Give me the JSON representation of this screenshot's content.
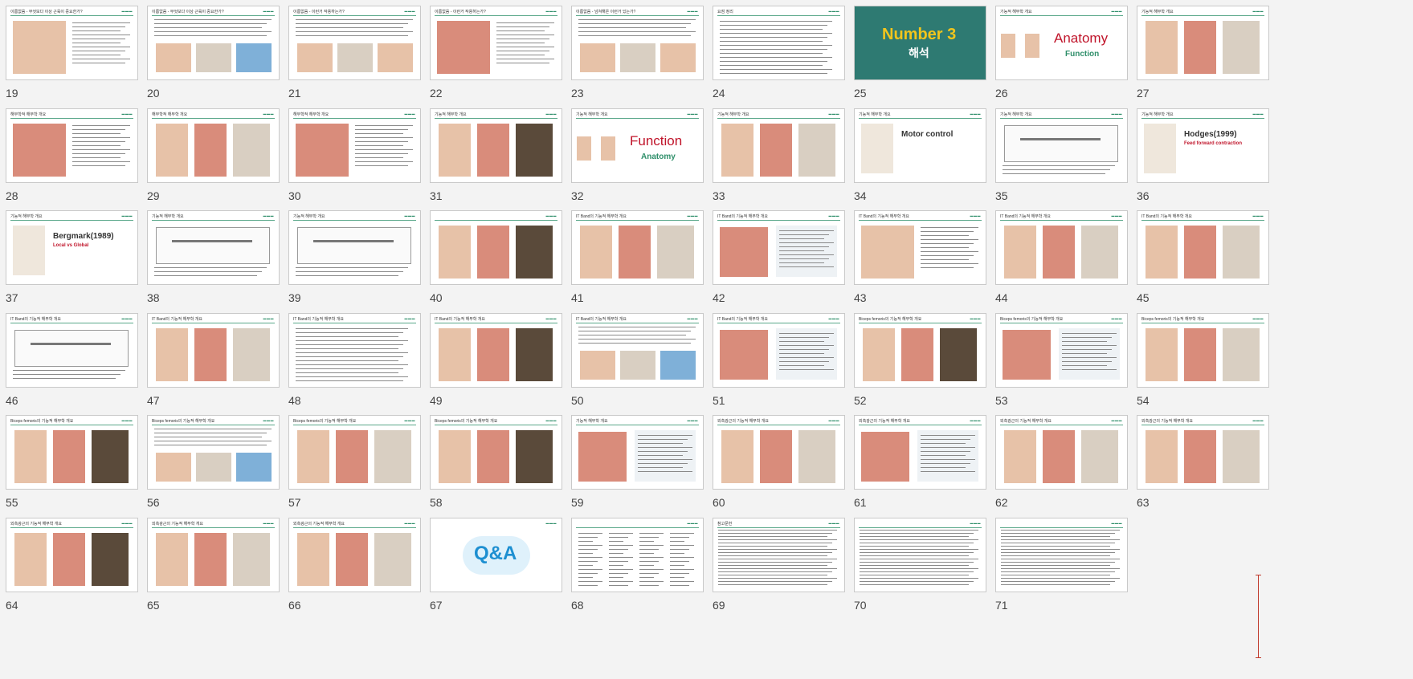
{
  "slides": [
    {
      "n": "19",
      "title": "이름없음 - 무엇보다 이상 근육이 중요한가?",
      "kind": "image-text"
    },
    {
      "n": "20",
      "title": "이름없음 - 무엇보다 이상 근육이 중요한가?",
      "kind": "text-images"
    },
    {
      "n": "21",
      "title": "이름없음 - 이런거 작용하는가?",
      "kind": "text-images"
    },
    {
      "n": "22",
      "title": "이름없음 - 이런거 작용하는가?",
      "kind": "image-text"
    },
    {
      "n": "23",
      "title": "이름없음 - 넘쳐해온 이런거 있는가?",
      "kind": "text-images"
    },
    {
      "n": "24",
      "title": "요점 정리",
      "kind": "text"
    },
    {
      "n": "25",
      "title": "",
      "kind": "cover",
      "big": "Number 3",
      "sub": "해석"
    },
    {
      "n": "26",
      "title": "기능적 해부학 개요",
      "kind": "label",
      "big": "Anatomy",
      "sub": "Function"
    },
    {
      "n": "27",
      "title": "기능적 해부학 개요",
      "kind": "images"
    },
    {
      "n": "28",
      "title": "해부학적 해부학 개요",
      "kind": "image-text"
    },
    {
      "n": "29",
      "title": "해부학적 해부학 개요",
      "kind": "images"
    },
    {
      "n": "30",
      "title": "해부학적 해부학 개요",
      "kind": "image-text"
    },
    {
      "n": "31",
      "title": "기능적 해부학 개요",
      "kind": "images"
    },
    {
      "n": "32",
      "title": "기능적 해부학 개요",
      "kind": "label",
      "big": "Function",
      "sub": "Anatomy"
    },
    {
      "n": "33",
      "title": "기능적 해부학 개요",
      "kind": "images"
    },
    {
      "n": "34",
      "title": "기능적 해부학 개요",
      "kind": "label-small",
      "big": "Motor control",
      "sub": ""
    },
    {
      "n": "35",
      "title": "기능적 해부학 개요",
      "kind": "diagram"
    },
    {
      "n": "36",
      "title": "기능적 해부학 개요",
      "kind": "label-small",
      "big": "Hodges(1999)",
      "sub": "Feed forward contraction"
    },
    {
      "n": "37",
      "title": "기능적 해부학 개요",
      "kind": "label-small",
      "big": "Bergmark(1989)",
      "sub": "Local vs Global"
    },
    {
      "n": "38",
      "title": "기능적 해부학 개요",
      "kind": "diagram"
    },
    {
      "n": "39",
      "title": "기능적 해부학 개요",
      "kind": "diagram"
    },
    {
      "n": "40",
      "title": "",
      "kind": "images"
    },
    {
      "n": "41",
      "title": "IT Band의 기능적 해부학 개요",
      "kind": "images"
    },
    {
      "n": "42",
      "title": "IT Band의 기능적 해부학 개요",
      "kind": "table"
    },
    {
      "n": "43",
      "title": "IT Band의 기능적 해부학 개요",
      "kind": "image-text"
    },
    {
      "n": "44",
      "title": "IT Band의 기능적 해부학 개요",
      "kind": "images"
    },
    {
      "n": "45",
      "title": "IT Band의 기능적 해부학 개요",
      "kind": "images"
    },
    {
      "n": "46",
      "title": "IT Band의 기능적 해부학 개요",
      "kind": "diagram"
    },
    {
      "n": "47",
      "title": "IT Band의 기능적 해부학 개요",
      "kind": "images"
    },
    {
      "n": "48",
      "title": "IT Band의 기능적 해부학 개요",
      "kind": "text"
    },
    {
      "n": "49",
      "title": "IT Band의 기능적 해부학 개요",
      "kind": "images"
    },
    {
      "n": "50",
      "title": "IT Band의 기능적 해부학 개요",
      "kind": "text-images"
    },
    {
      "n": "51",
      "title": "IT Band의 기능적 해부학 개요",
      "kind": "table"
    },
    {
      "n": "52",
      "title": "Biceps femoris의 기능적 해부학 개요",
      "kind": "images"
    },
    {
      "n": "53",
      "title": "Biceps femoris의 기능적 해부학 개요",
      "kind": "table"
    },
    {
      "n": "54",
      "title": "Biceps femoris의 기능적 해부학 개요",
      "kind": "images"
    },
    {
      "n": "55",
      "title": "Biceps femoris의 기능적 해부학 개요",
      "kind": "images"
    },
    {
      "n": "56",
      "title": "Biceps femoris의 기능적 해부학 개요",
      "kind": "text-images"
    },
    {
      "n": "57",
      "title": "Biceps femoris의 기능적 해부학 개요",
      "kind": "images"
    },
    {
      "n": "58",
      "title": "Biceps femoris의 기능적 해부학 개요",
      "kind": "images"
    },
    {
      "n": "59",
      "title": "기능적 해부학 개요",
      "kind": "table"
    },
    {
      "n": "60",
      "title": "외측광근의 기능적 해부학 개요",
      "kind": "images"
    },
    {
      "n": "61",
      "title": "외측광근의 기능적 해부학 개요",
      "kind": "table"
    },
    {
      "n": "62",
      "title": "외측광근의 기능적 해부학 개요",
      "kind": "images"
    },
    {
      "n": "63",
      "title": "외측광근의 기능적 해부학 개요",
      "kind": "images"
    },
    {
      "n": "64",
      "title": "외측광근의 기능적 해부학 개요",
      "kind": "images"
    },
    {
      "n": "65",
      "title": "외측광근의 기능적 해부학 개요",
      "kind": "images"
    },
    {
      "n": "66",
      "title": "외측광근의 기능적 해부학 개요",
      "kind": "images"
    },
    {
      "n": "67",
      "title": "",
      "kind": "qa",
      "big": "Q&A"
    },
    {
      "n": "68",
      "title": "",
      "kind": "list"
    },
    {
      "n": "69",
      "title": "참고문헌",
      "kind": "refs"
    },
    {
      "n": "70",
      "title": "",
      "kind": "refs"
    },
    {
      "n": "71",
      "title": "",
      "kind": "refs"
    }
  ],
  "colors": {
    "accent_green": "#2f8f6a",
    "cover_bg": "#2e7a72",
    "cover_title": "#f2c51c",
    "red_label": "#c0142a",
    "selection_marker": "#c0392b"
  }
}
